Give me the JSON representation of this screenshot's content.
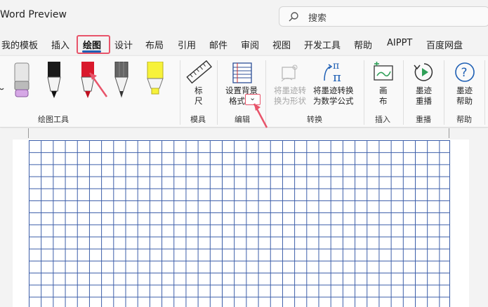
{
  "app": {
    "title": "Word Preview"
  },
  "search": {
    "placeholder": "搜索"
  },
  "tabs": [
    {
      "label": "我的模板"
    },
    {
      "label": "插入"
    },
    {
      "label": "绘图"
    },
    {
      "label": "设计"
    },
    {
      "label": "布局"
    },
    {
      "label": "引用"
    },
    {
      "label": "邮件"
    },
    {
      "label": "审阅"
    },
    {
      "label": "视图"
    },
    {
      "label": "开发工具"
    },
    {
      "label": "帮助"
    },
    {
      "label": "AIPPT"
    },
    {
      "label": "百度网盘"
    }
  ],
  "active_tab": "绘图",
  "ribbon": {
    "groups": {
      "drawing_tools": "绘图工具",
      "stencils": "模具",
      "edit": "编辑",
      "convert": "转换",
      "insert": "插入",
      "replay": "重播",
      "help": "帮助"
    },
    "pens": [
      {
        "name": "eraser",
        "color": "#d6a8e6"
      },
      {
        "name": "black-pen",
        "color": "#111111"
      },
      {
        "name": "red-pen",
        "color": "#d9192c"
      },
      {
        "name": "pencil",
        "color": "#555555"
      },
      {
        "name": "highlighter",
        "color": "#f7f23a"
      }
    ],
    "buttons": {
      "ruler_line1": "标",
      "ruler_line2": "尺",
      "bg_format_line1": "设置背景",
      "bg_format_line2": "格式",
      "ink_to_shape_line1": "将墨迹转",
      "ink_to_shape_line2": "换为形状",
      "ink_to_math_line1": "将墨迹转换",
      "ink_to_math_line2": "为数学公式",
      "canvas_line1": "画",
      "canvas_line2": "布",
      "ink_replay_line1": "墨迹",
      "ink_replay_line2": "重播",
      "ink_help_line1": "墨迹",
      "ink_help_line2": "帮助"
    },
    "dropdown_glyph": "⌄"
  },
  "colors": {
    "accent": "#1e5fb4",
    "highlight_annotation": "#e8546a",
    "grid_line": "#3a5ca8",
    "replay_green": "#2e9f57"
  }
}
